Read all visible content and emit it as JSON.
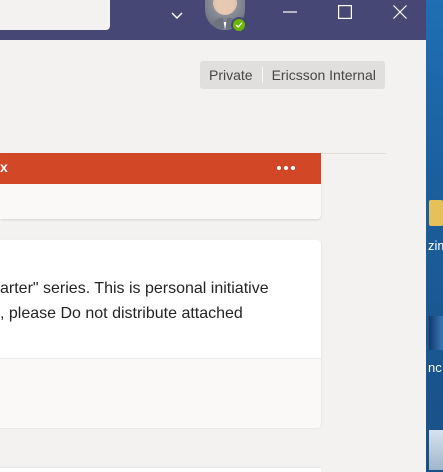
{
  "titlebar": {
    "chevron_icon": "chevron-down-icon",
    "avatar_icon": "user-avatar",
    "presence_icon": "check-icon",
    "minimize_icon": "minimize-icon",
    "maximize_icon": "maximize-icon",
    "close_icon": "close-icon"
  },
  "sensitivity": {
    "privacy": "Private",
    "label": "Ericsson Internal"
  },
  "card1": {
    "banner_label": "x",
    "banner_color": "#d24726",
    "more_icon": "more-options-icon"
  },
  "card2": {
    "line1": "arter\" series. This is personal initiative",
    "line2": ", please Do not distribute attached"
  },
  "desktop": {
    "label1": "zim",
    "label2": "nc"
  },
  "colors": {
    "titlebar": "#464775",
    "presence": "#6bb700",
    "background": "#f3f2f1"
  }
}
